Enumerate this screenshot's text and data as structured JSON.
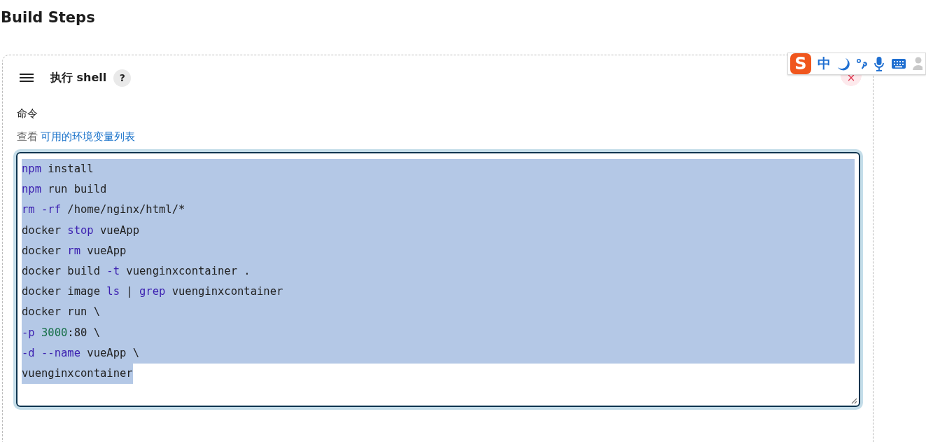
{
  "heading": "Build Steps",
  "step": {
    "title": "执行 shell",
    "help": "?",
    "close": "×",
    "field_label": "命令",
    "hint_prefix": "查看",
    "hint_link": "可用的环境变量列表",
    "code": [
      {
        "selected": true,
        "tokens": [
          {
            "t": "npm",
            "kind": "keyword"
          },
          {
            "t": " install",
            "kind": "plain"
          }
        ]
      },
      {
        "selected": true,
        "tokens": [
          {
            "t": "npm",
            "kind": "keyword"
          },
          {
            "t": " run build",
            "kind": "plain"
          }
        ]
      },
      {
        "selected": true,
        "tokens": [
          {
            "t": "rm",
            "kind": "keyword"
          },
          {
            "t": " -rf",
            "kind": "keyword"
          },
          {
            "t": " /home/nginx/html/*",
            "kind": "plain"
          }
        ]
      },
      {
        "selected": true,
        "tokens": [
          {
            "t": "docker ",
            "kind": "plain"
          },
          {
            "t": "stop",
            "kind": "keyword"
          },
          {
            "t": " vueApp",
            "kind": "plain"
          }
        ]
      },
      {
        "selected": true,
        "tokens": [
          {
            "t": "docker ",
            "kind": "plain"
          },
          {
            "t": "rm",
            "kind": "keyword"
          },
          {
            "t": " vueApp",
            "kind": "plain"
          }
        ]
      },
      {
        "selected": true,
        "tokens": [
          {
            "t": "docker build ",
            "kind": "plain"
          },
          {
            "t": "-t",
            "kind": "keyword"
          },
          {
            "t": " vuenginxcontainer .",
            "kind": "plain"
          }
        ]
      },
      {
        "selected": true,
        "tokens": [
          {
            "t": "docker image ",
            "kind": "plain"
          },
          {
            "t": "ls",
            "kind": "keyword"
          },
          {
            "t": " | ",
            "kind": "plain"
          },
          {
            "t": "grep",
            "kind": "keyword"
          },
          {
            "t": " vuenginxcontainer",
            "kind": "plain"
          }
        ]
      },
      {
        "selected": true,
        "tokens": [
          {
            "t": "docker run \\",
            "kind": "plain"
          }
        ]
      },
      {
        "selected": true,
        "tokens": [
          {
            "t": "-p",
            "kind": "keyword"
          },
          {
            "t": " 3000",
            "kind": "number"
          },
          {
            "t": ":80 \\",
            "kind": "plain"
          }
        ]
      },
      {
        "selected": true,
        "tokens": [
          {
            "t": "-d",
            "kind": "keyword"
          },
          {
            "t": " --name",
            "kind": "keyword"
          },
          {
            "t": " vueApp \\",
            "kind": "plain"
          }
        ]
      },
      {
        "selected": true,
        "tokens": [
          {
            "t": "vuenginxcontainer",
            "kind": "plain"
          }
        ]
      }
    ]
  },
  "ime_toolbar": {
    "logo": "S",
    "mode": "中"
  }
}
